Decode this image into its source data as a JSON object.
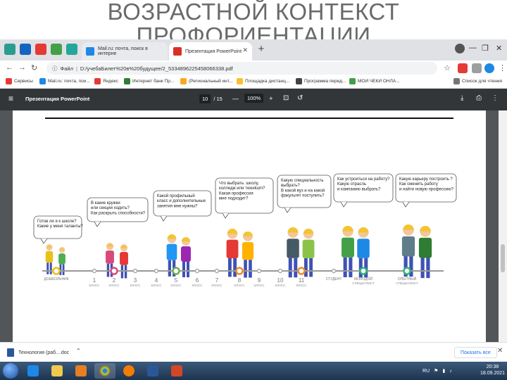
{
  "slide": {
    "title_line1": "ВОЗРАСТНОЙ КОНТЕКСТ",
    "title_line2": "ПРОФОРИЕНТАЦИИ"
  },
  "browser": {
    "tabs": [
      {
        "label": "Mail.ru: почта, поиск в интерне",
        "active": false
      },
      {
        "label": "Презентация PowerPoint",
        "active": true
      }
    ],
    "window_controls": [
      "—",
      "❐",
      "✕"
    ],
    "address": {
      "file_label": "Файл",
      "path": "D:/учебаБилет%20в%20будущее/2_5334896225458066338.pdf"
    },
    "bookmarks": [
      "Сервисы",
      "Mail.ru: почта, пои...",
      "Яндекс",
      "Интернет банк Пр...",
      "(Региональный инт...",
      "Площадка дистанц...",
      "Программа перед...",
      "МОИ ЧЕКИ ОНЛА...",
      "Список для чтения"
    ]
  },
  "pdf": {
    "title": "Презентация PowerPoint",
    "current_page": "10",
    "total_pages": "/ 15",
    "zoom": "100%",
    "zoom_out": "—",
    "zoom_in": "+"
  },
  "infographic": {
    "bubbles": [
      "Готов ли я к школе?\nКакие у меня таланты?",
      "В какие кружки\nили секции ходить?\nКак раскрыть способности?",
      "Какой профильный\nкласс и дополнительные\nзанятия мне нужны?",
      "Что выбрать: школу,\nколледж или технikum?\nКакая профессия\nмне подходит?",
      "Какую специальность\nвыбрать?\nВ какой вуз и на какой\nфакультет поступить?",
      "Как устроиться на работу?\nКакую отрасль\nи компанию выбрать?",
      "Какую карьеру построить ?\nКак сменить работу\nи найти новую профессию?"
    ],
    "timeline": [
      {
        "label": "ДОШКОЛЬНИК",
        "sub": "",
        "color": "#e8c21a"
      },
      {
        "label": "1",
        "sub": "КЛАСС",
        "color": "#aaaaaa"
      },
      {
        "label": "2",
        "sub": "КЛАСС",
        "color": "#d84a7a"
      },
      {
        "label": "3",
        "sub": "КЛАСС",
        "color": "#aaaaaa"
      },
      {
        "label": "4",
        "sub": "КЛАСС",
        "color": "#aaaaaa"
      },
      {
        "label": "5",
        "sub": "КЛАСС",
        "color": "#6ab04c"
      },
      {
        "label": "6",
        "sub": "КЛАСС",
        "color": "#aaaaaa"
      },
      {
        "label": "7",
        "sub": "КЛАСС",
        "color": "#aaaaaa"
      },
      {
        "label": "8",
        "sub": "КЛАСС",
        "color": "#f08a24"
      },
      {
        "label": "9",
        "sub": "КЛАСС",
        "color": "#aaaaaa"
      },
      {
        "label": "10",
        "sub": "КЛАСС",
        "color": "#aaaaaa"
      },
      {
        "label": "11",
        "sub": "КЛАСС",
        "color": "#f08a24"
      },
      {
        "label": "СТУДЕНТ",
        "sub": "",
        "color": "#aaaaaa"
      },
      {
        "label": "МОЛОДОЙ",
        "sub": "СПЕЦИАЛИСТ",
        "color": "#2bb673"
      },
      {
        "label": "ОПЫТНЫЙ",
        "sub": "СПЕЦИАЛИСТ",
        "color": "#2bb673"
      }
    ]
  },
  "download": {
    "filename": "Технология (раб....doc",
    "show_all": "Показать все"
  },
  "taskbar": {
    "lang": "RU",
    "time": "20:38",
    "date": "18.09.2021"
  }
}
